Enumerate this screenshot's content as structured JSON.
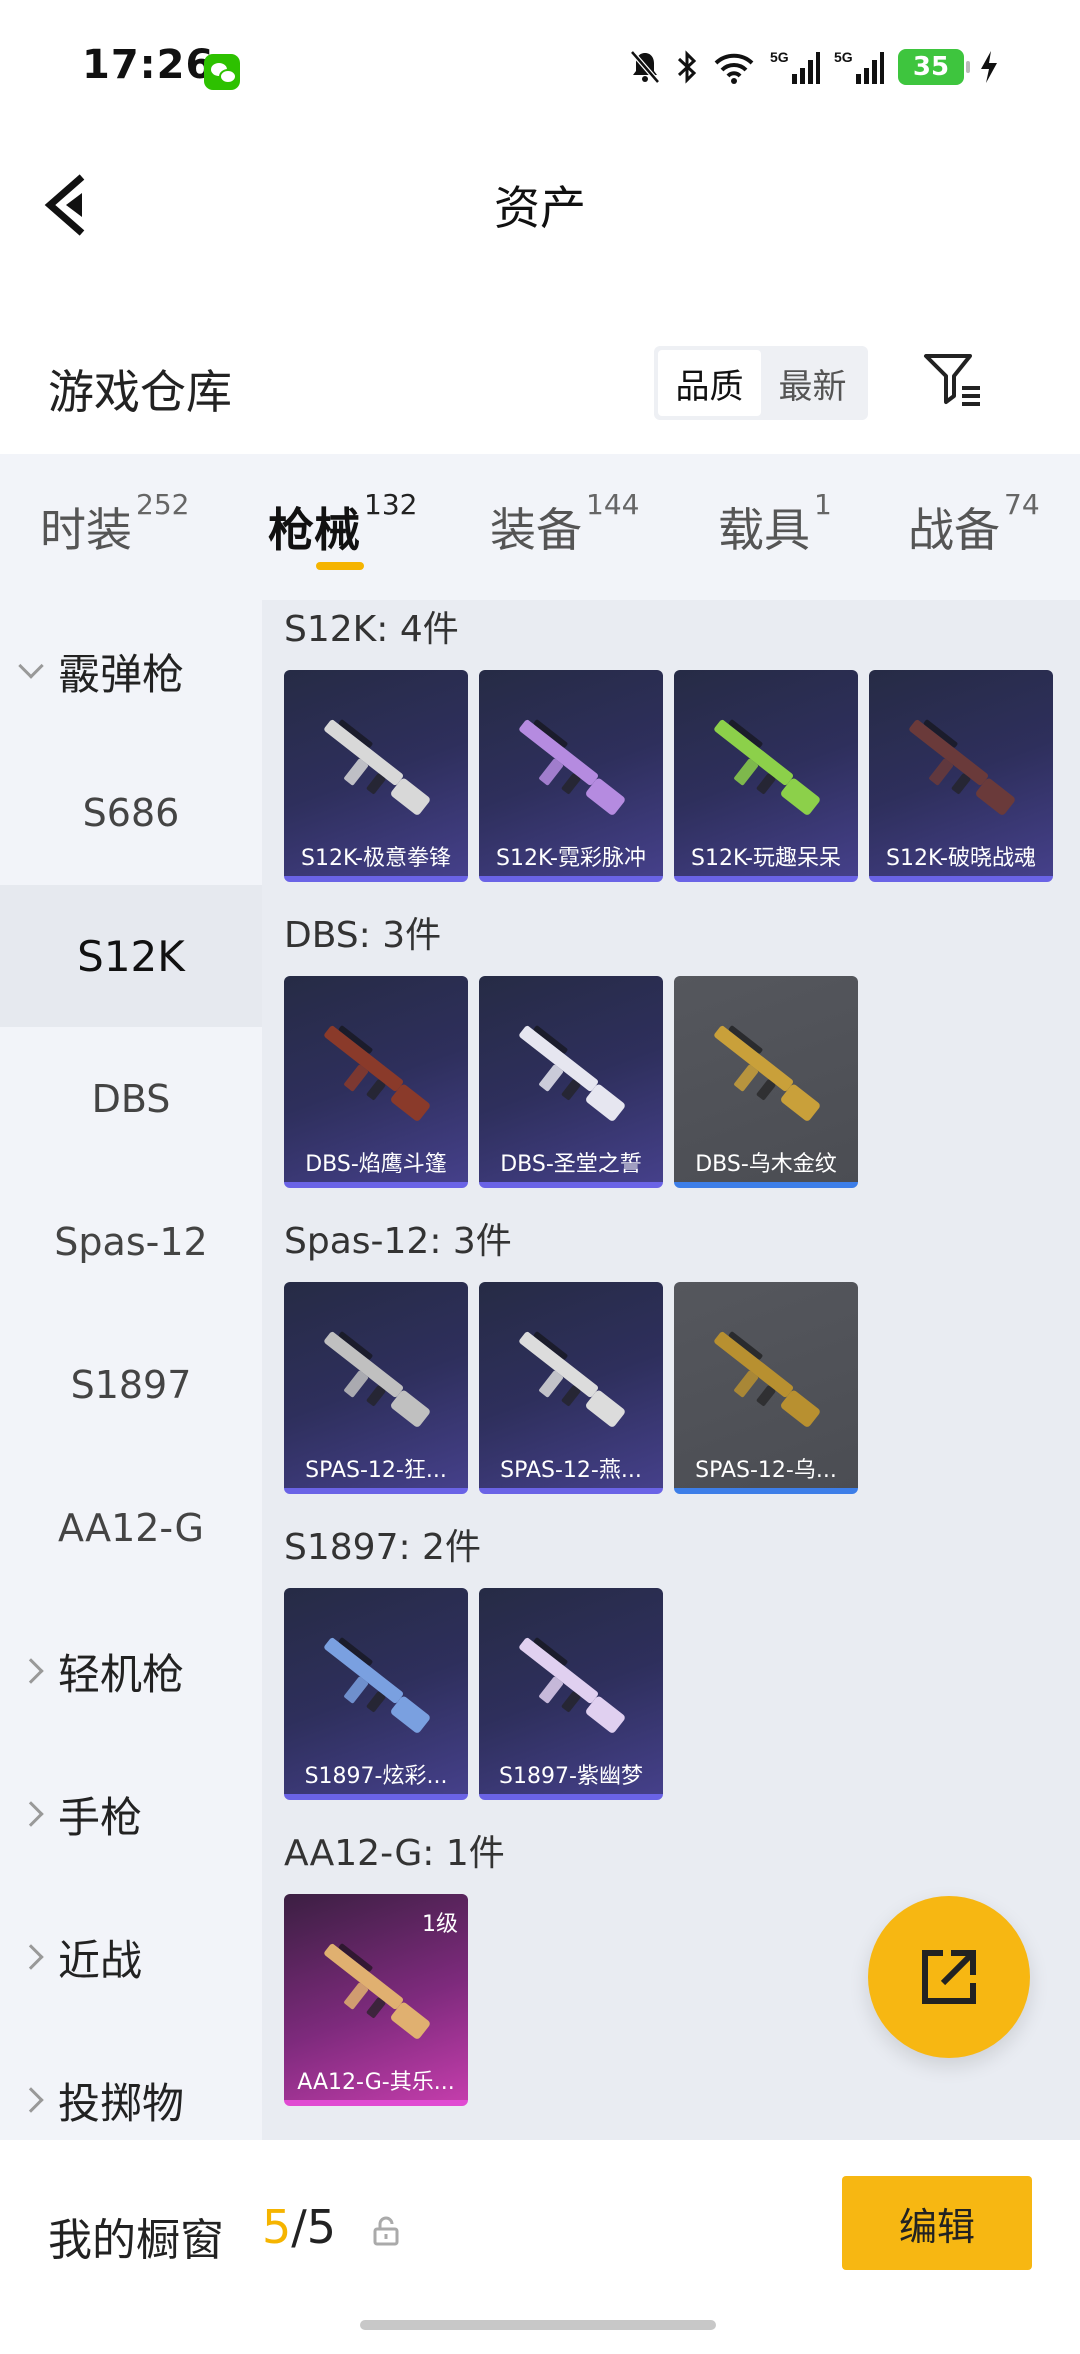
{
  "status_bar": {
    "time": "17:26",
    "battery": "35",
    "network_1": "5G",
    "network_2": "5G"
  },
  "header": {
    "title": "资产"
  },
  "warehouse": {
    "title": "游戏仓库",
    "sort_options": [
      "品质",
      "最新"
    ],
    "sort_selected": "品质"
  },
  "tabs": [
    {
      "label": "时装",
      "count": "252",
      "active": false
    },
    {
      "label": "枪械",
      "count": "132",
      "active": true
    },
    {
      "label": "装备",
      "count": "144",
      "active": false
    },
    {
      "label": "载具",
      "count": "1",
      "active": false
    },
    {
      "label": "战备",
      "count": "74",
      "active": false
    }
  ],
  "sidebar": {
    "expanded_group": "霰弹枪",
    "sub_items": [
      "S686",
      "S12K",
      "DBS",
      "Spas-12",
      "S1897",
      "AA12-G"
    ],
    "selected": "S12K",
    "collapsed_groups": [
      "轻机枪",
      "手枪",
      "近战",
      "投掷物"
    ]
  },
  "groups": [
    {
      "label": "S12K: 4件",
      "items": [
        {
          "name": "S12K-极意拳锋",
          "style": "purple",
          "color": "#d8d8d8"
        },
        {
          "name": "S12K-霓彩脉冲",
          "style": "purple",
          "color": "#b58be0"
        },
        {
          "name": "S12K-玩趣呆呆",
          "style": "purple",
          "color": "#8cd04a"
        },
        {
          "name": "S12K-破晓战魂",
          "style": "purple",
          "color": "#6a3a3a"
        }
      ]
    },
    {
      "label": "DBS: 3件",
      "items": [
        {
          "name": "DBS-焰鹰斗篷",
          "style": "purple",
          "color": "#8a3a2a"
        },
        {
          "name": "DBS-圣堂之誓",
          "style": "purple",
          "color": "#e6e6f0"
        },
        {
          "name": "DBS-乌木金纹",
          "style": "grey",
          "color": "#c9a03a"
        }
      ]
    },
    {
      "label": "Spas-12: 3件",
      "items": [
        {
          "name": "SPAS-12-狂...",
          "style": "purple",
          "color": "#c0c0c0"
        },
        {
          "name": "SPAS-12-燕...",
          "style": "purple",
          "color": "#dcdcdc"
        },
        {
          "name": "SPAS-12-乌...",
          "style": "grey",
          "color": "#b89030"
        }
      ]
    },
    {
      "label": "S1897: 2件",
      "items": [
        {
          "name": "S1897-炫彩...",
          "style": "purple",
          "color": "#7aa0e0"
        },
        {
          "name": "S1897-紫幽梦",
          "style": "purple",
          "color": "#e0d0f0"
        }
      ]
    },
    {
      "label": "AA12-G: 1件",
      "items": [
        {
          "name": "AA12-G-其乐...",
          "style": "pink",
          "color": "#e0b070",
          "level": "1级"
        }
      ]
    }
  ],
  "showcase": {
    "label": "我的橱窗",
    "current": "5",
    "separator": "/",
    "total": "5",
    "edit_label": "编辑"
  },
  "colors": {
    "accent": "#f7b712",
    "sidebar_bg": "#f2f4f9",
    "content_bg": "#e9ecf2"
  }
}
